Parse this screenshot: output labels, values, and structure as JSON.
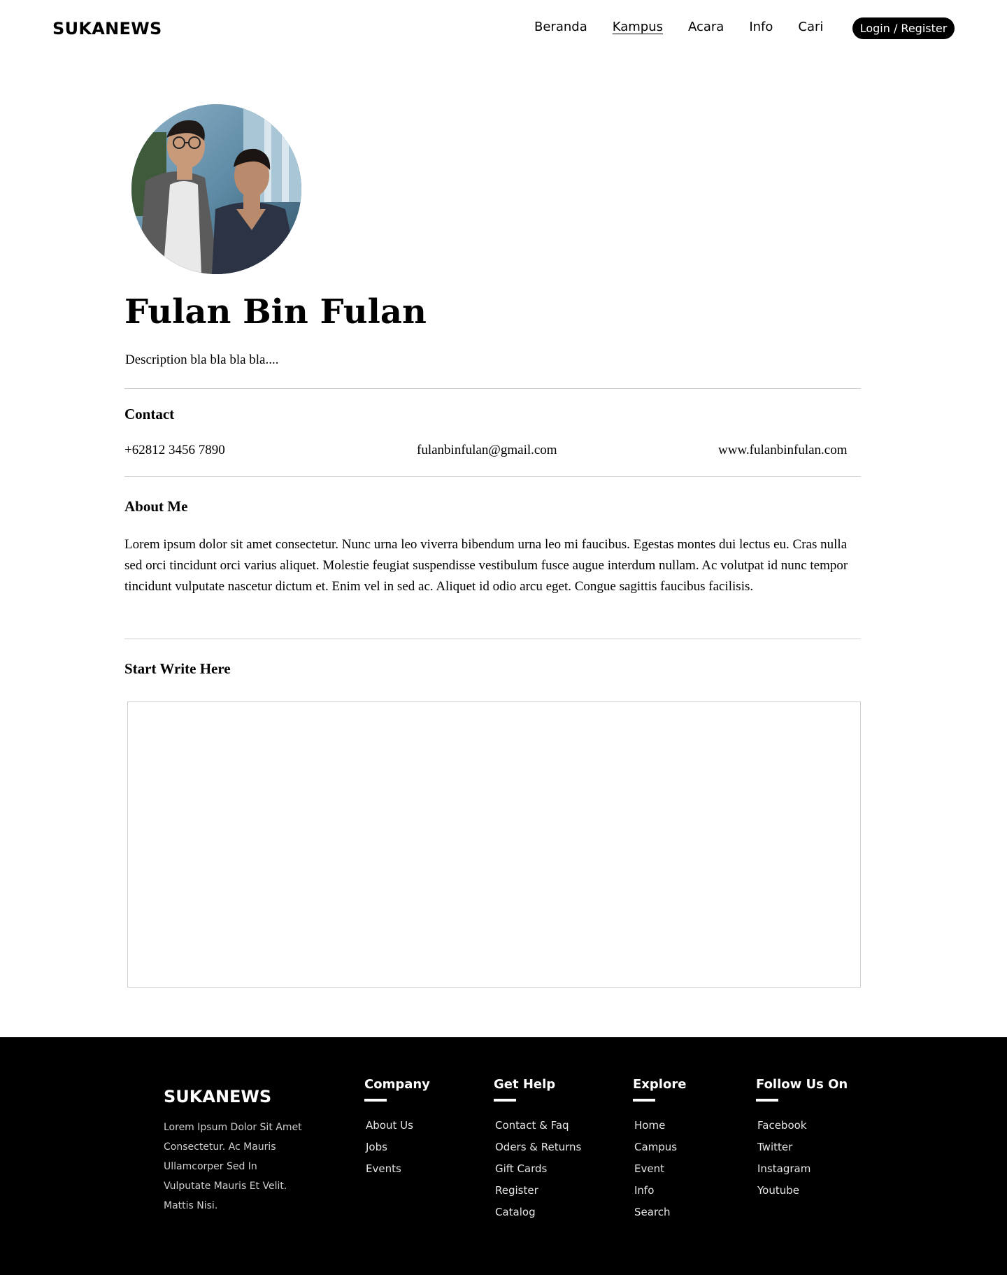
{
  "header": {
    "logo": "SUKANEWS",
    "nav": [
      "Beranda",
      "Kampus",
      "Acara",
      "Info",
      "Cari"
    ],
    "active_nav": "Kampus",
    "login_label": "Login / Register"
  },
  "profile": {
    "avatar_icon": "profile-photo",
    "name": "Fulan Bin Fulan",
    "description": "Description bla bla bla bla...."
  },
  "contact": {
    "title": "Contact",
    "phone": "+62812 3456 7890",
    "email": "fulanbinfulan@gmail.com",
    "website": "www.fulanbinfulan.com"
  },
  "about": {
    "title": "About Me",
    "text": "Lorem ipsum dolor sit amet consectetur. Nunc urna leo viverra bibendum urna leo mi faucibus. Egestas montes dui lectus eu. Cras nulla sed orci tincidunt orci varius aliquet. Molestie feugiat suspendisse vestibulum fusce augue interdum nullam. Ac volutpat id nunc tempor tincidunt vulputate nascetur dictum et. Enim vel in sed ac. Aliquet id odio arcu eget. Congue sagittis faucibus facilisis."
  },
  "write": {
    "title": "Start Write Here",
    "value": ""
  },
  "footer": {
    "logo": "SUKANEWS",
    "description": "Lorem Ipsum Dolor Sit Amet Consectetur. Ac Mauris Ullamcorper Sed In Vulputate Mauris Et Velit. Mattis Nisi.",
    "columns": [
      {
        "title": "Company",
        "links": [
          "About Us",
          "Jobs",
          "Events"
        ]
      },
      {
        "title": "Get Help",
        "links": [
          "Contact & Faq",
          "Oders & Returns",
          "Gift Cards",
          "Register",
          "Catalog"
        ]
      },
      {
        "title": "Explore",
        "links": [
          "Home",
          "Campus",
          "Event",
          "Info",
          "Search"
        ]
      },
      {
        "title": "Follow Us On",
        "links": [
          "Facebook",
          "Twitter",
          "Instagram",
          "Youtube"
        ]
      }
    ]
  },
  "colors": {
    "background": "#ffffff",
    "footer_bg": "#000000",
    "divider": "#cfcfcf",
    "button_bg": "#000000"
  }
}
